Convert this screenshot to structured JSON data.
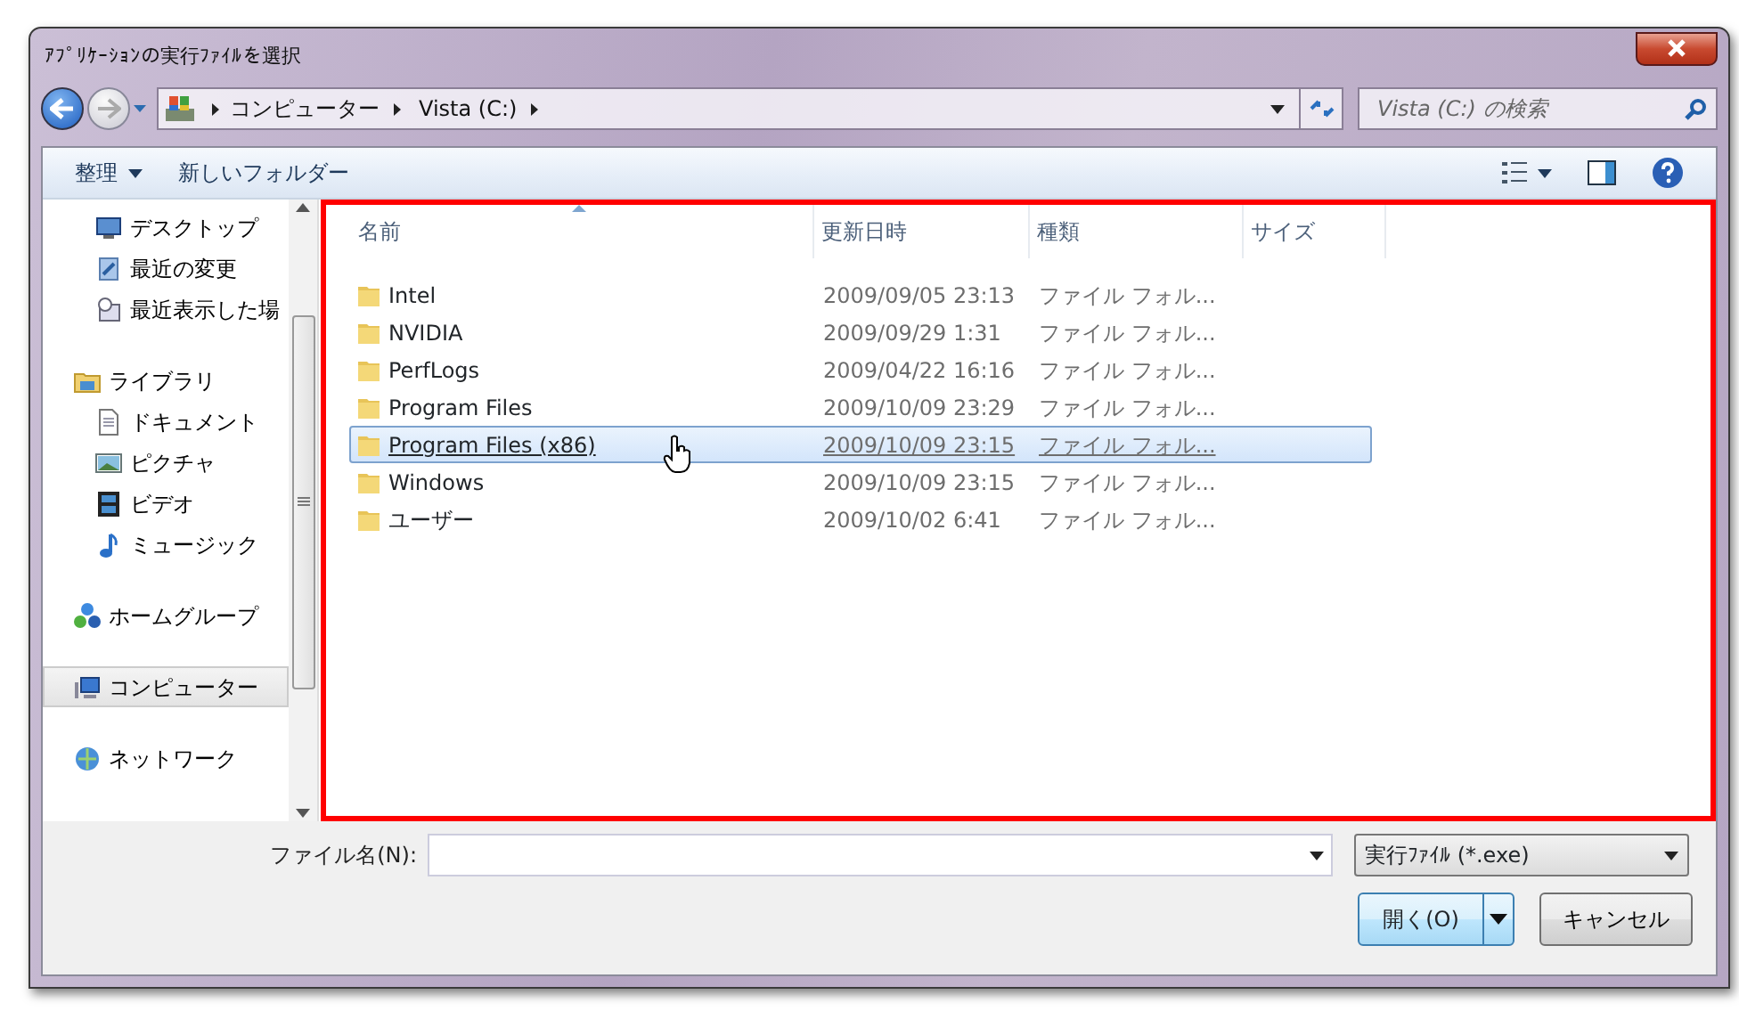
{
  "window": {
    "title": "ｱﾌﾟﾘｹｰｼｮﾝの実行ﾌｧｲﾙを選択"
  },
  "address": {
    "crumbs": [
      "コンピューター",
      "Vista (C:)"
    ],
    "search_placeholder": "Vista (C:) の検索"
  },
  "toolbar": {
    "items": [
      {
        "label": "整理",
        "dropdown": true
      },
      {
        "label": "新しいフォルダー",
        "dropdown": false
      }
    ]
  },
  "sidebar": {
    "items": [
      {
        "children": [
          {
            "label": "デスクトップ",
            "kind": "desktop",
            "selected": false
          },
          {
            "label": "最近の変更",
            "kind": "recent",
            "selected": false
          },
          {
            "label": "最近表示した場",
            "kind": "places",
            "selected": false
          }
        ]
      },
      {
        "label": "ライブラリ",
        "kind": "library",
        "selected": false,
        "children": [
          {
            "label": "ドキュメント",
            "kind": "document",
            "selected": false
          },
          {
            "label": "ピクチャ",
            "kind": "picture",
            "selected": false
          },
          {
            "label": "ビデオ",
            "kind": "video",
            "selected": false
          },
          {
            "label": "ミュージック",
            "kind": "music",
            "selected": false
          }
        ]
      },
      {
        "label": "ホームグループ",
        "kind": "homegroup",
        "selected": false
      },
      {
        "label": "コンピューター",
        "kind": "computer",
        "selected": true
      },
      {
        "label": "ネットワーク",
        "kind": "network",
        "selected": false
      }
    ]
  },
  "table": {
    "columns": [
      {
        "label": "名前",
        "sorted": true
      },
      {
        "label": "更新日時",
        "sorted": false
      },
      {
        "label": "種類",
        "sorted": false
      },
      {
        "label": "サイズ",
        "sorted": false
      }
    ],
    "rows": [
      {
        "name": "Intel",
        "modified": "2009/09/05 23:13",
        "type": "ファイル フォル...",
        "selected": false
      },
      {
        "name": "NVIDIA",
        "modified": "2009/09/29 1:31",
        "type": "ファイル フォル...",
        "selected": false
      },
      {
        "name": "PerfLogs",
        "modified": "2009/04/22 16:16",
        "type": "ファイル フォル...",
        "selected": false
      },
      {
        "name": "Program Files",
        "modified": "2009/10/09 23:29",
        "type": "ファイル フォル...",
        "selected": false
      },
      {
        "name": "Program Files (x86)",
        "modified": "2009/10/09 23:15",
        "type": "ファイル フォル...",
        "selected": true
      },
      {
        "name": "Windows",
        "modified": "2009/10/09 23:15",
        "type": "ファイル フォル...",
        "selected": false
      },
      {
        "name": "ユーザー",
        "modified": "2009/10/02 6:41",
        "type": "ファイル フォル...",
        "selected": false
      }
    ]
  },
  "footer": {
    "filename_label": "ファイル名(N):",
    "file_type": "実行ﾌｧｲﾙ (*.exe)",
    "buttons": [
      {
        "label": "開く(O)",
        "kind": "split"
      },
      {
        "label": "キャンセル",
        "kind": "plain"
      }
    ]
  }
}
